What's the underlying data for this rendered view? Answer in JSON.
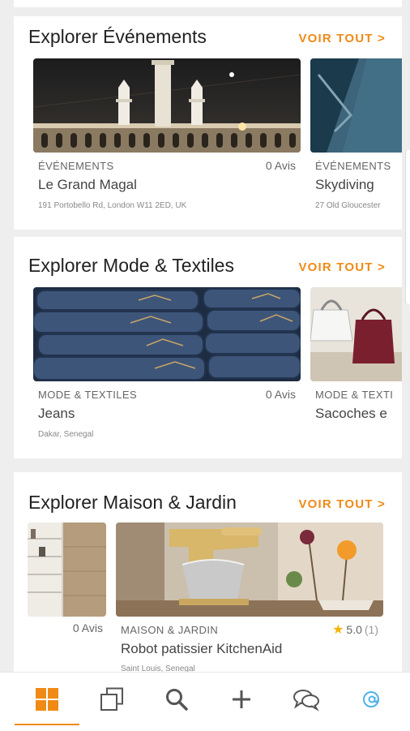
{
  "sections": [
    {
      "title": "Explorer Événements",
      "see_all": "VOIR TOUT >",
      "items": [
        {
          "category": "ÉVÉNEMENTS",
          "title": "Le Grand Magal",
          "address": "191 Portobello Rd, London W11 2ED, UK",
          "reviews": "0 Avis"
        },
        {
          "category": "ÉVÉNEMENTS",
          "title": "Skydiving",
          "address": "27 Old Gloucester"
        }
      ]
    },
    {
      "title": "Explorer Mode & Textiles",
      "see_all": "VOIR TOUT >",
      "items": [
        {
          "category": "MODE & TEXTILES",
          "title": "Jeans",
          "address": "Dakar, Senegal",
          "reviews": "0 Avis"
        },
        {
          "category": "MODE & TEXTI",
          "title": "Sacoches e"
        }
      ]
    },
    {
      "title": "Explorer Maison & Jardin",
      "see_all": "VOIR TOUT >",
      "items": [
        {
          "reviews": "0 Avis"
        },
        {
          "category": "MAISON & JARDIN",
          "title": "Robot patissier KitchenAid",
          "address": "Saint Louis, Senegal",
          "rating": "5.0",
          "rating_count": "(1)"
        }
      ]
    }
  ],
  "bottom_nav": {
    "items": [
      {
        "icon": "grid-icon",
        "active": true
      },
      {
        "icon": "copy-icon"
      },
      {
        "icon": "search-icon"
      },
      {
        "icon": "plus-icon"
      },
      {
        "icon": "chat-icon"
      },
      {
        "icon": "at-icon"
      }
    ],
    "accent": "#f08a16"
  }
}
